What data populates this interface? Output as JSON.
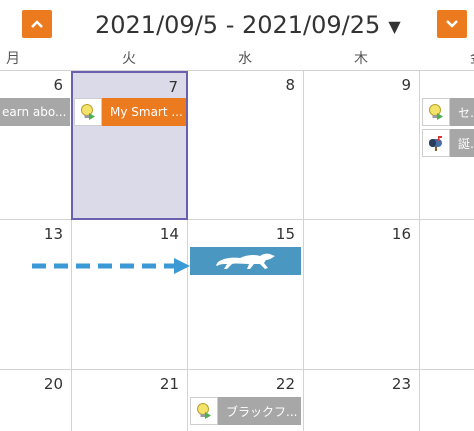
{
  "header": {
    "date_range": "2021/09/5 - 2021/09/25",
    "caret": "▼"
  },
  "weekdays": [
    "月",
    "火",
    "水",
    "木",
    "金"
  ],
  "weeks": [
    {
      "days": [
        "6",
        "7",
        "8",
        "9",
        ""
      ]
    },
    {
      "days": [
        "13",
        "14",
        "15",
        "16",
        ""
      ]
    },
    {
      "days": [
        "20",
        "21",
        "22",
        "23",
        ""
      ]
    }
  ],
  "events": {
    "learn_about": "earn abo...",
    "my_smart": "My Smart ...",
    "se": "セー",
    "birthday": "誕生",
    "black_friday": "ブラックフ..."
  },
  "colors": {
    "accent_orange": "#ec7a1f",
    "selected_bg": "#dadae8",
    "selected_border": "#6a60b0",
    "event_gray": "#a7a7a7",
    "event_blue": "#4a97c2",
    "arrow_blue": "#3b9ad6"
  }
}
